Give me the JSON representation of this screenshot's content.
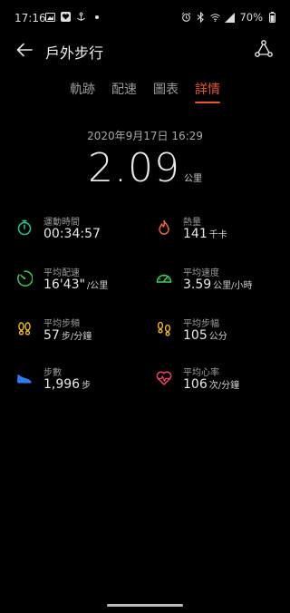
{
  "status_bar": {
    "time": "17:16",
    "battery": "70%",
    "left_icons": [
      "gallery-icon",
      "health-icon",
      "anchor-icon",
      "dot-icon"
    ],
    "right_icons": [
      "alarm-icon",
      "bluetooth-icon",
      "wifi-icon",
      "signal-icon",
      "battery-icon"
    ]
  },
  "header": {
    "title": "戶外步行"
  },
  "tabs": [
    {
      "label": "軌跡",
      "active": false
    },
    {
      "label": "配速",
      "active": false
    },
    {
      "label": "圖表",
      "active": false
    },
    {
      "label": "詳情",
      "active": true
    }
  ],
  "summary": {
    "datetime": "2020年9月17日 16:29",
    "distance": "2.09",
    "distance_unit": "公里"
  },
  "metrics": [
    {
      "label": "運動時間",
      "value": "00:34:57",
      "unit": "",
      "icon": "stopwatch-icon",
      "color": "#20c997"
    },
    {
      "label": "熱量",
      "value": "141",
      "unit": "千卡",
      "icon": "flame-icon",
      "color": "#f0643c"
    },
    {
      "label": "平均配速",
      "value": "16'43\"",
      "unit": "/公里",
      "icon": "pace-gauge-icon",
      "color": "#3ccf4e"
    },
    {
      "label": "平均速度",
      "value": "3.59",
      "unit": "公里/小時",
      "icon": "speedometer-icon",
      "color": "#3ccf4e"
    },
    {
      "label": "平均步頻",
      "value": "57",
      "unit": "步/分鐘",
      "icon": "footprints-icon",
      "color": "#f2b51e"
    },
    {
      "label": "平均步幅",
      "value": "105",
      "unit": "公分",
      "icon": "footprints-icon",
      "color": "#f2b51e"
    },
    {
      "label": "步數",
      "value": "1,996",
      "unit": "步",
      "icon": "shoe-icon",
      "color": "#2f7bf5"
    },
    {
      "label": "平均心率",
      "value": "106",
      "unit": "次/分鐘",
      "icon": "heart-rate-icon",
      "color": "#f0445a"
    }
  ],
  "colors": {
    "accent": "#e8572b",
    "background": "#000000"
  }
}
